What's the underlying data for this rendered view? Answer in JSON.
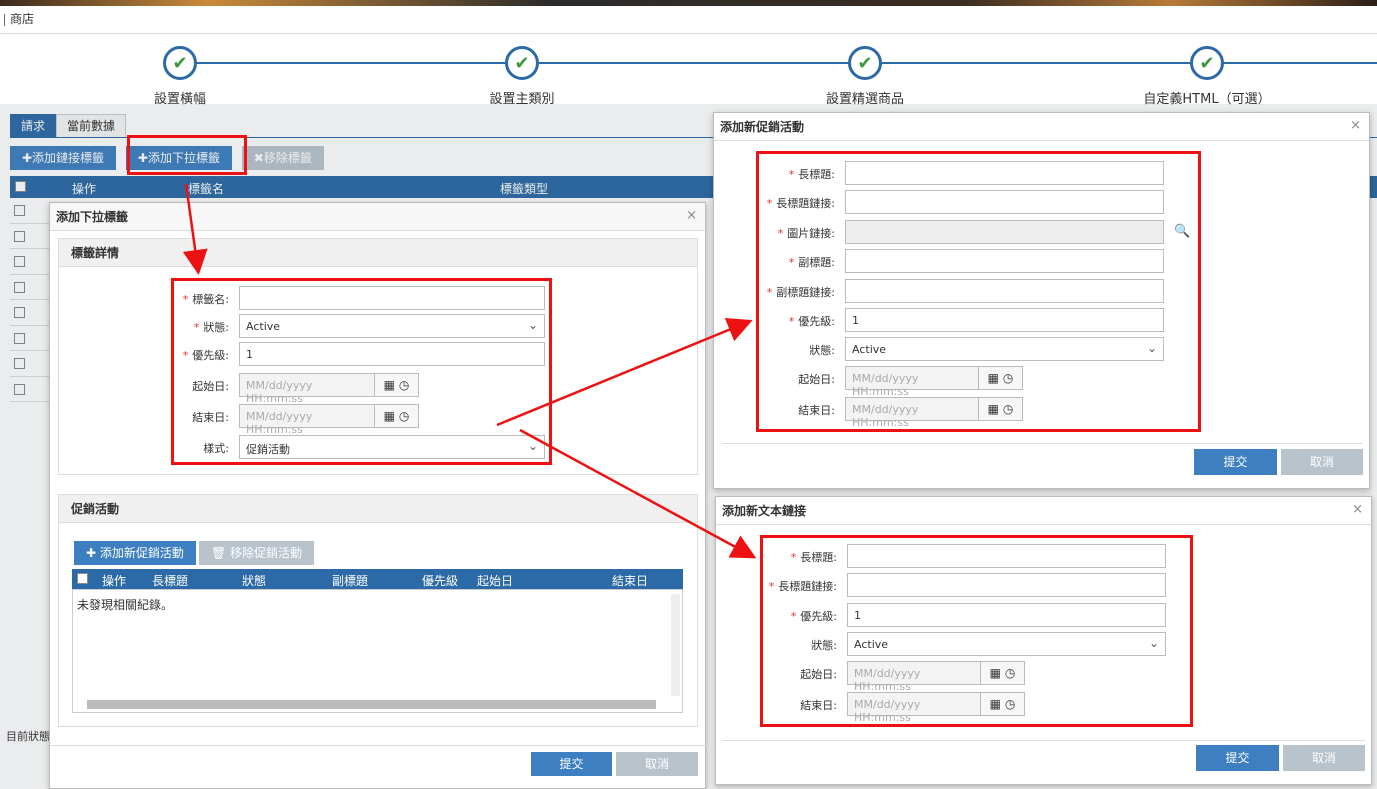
{
  "breadcrumb": "商店",
  "wizard": {
    "steps": [
      {
        "label": "設置橫幅",
        "check": "✔"
      },
      {
        "label": "設置主類別",
        "check": "✔"
      },
      {
        "label": "設置精選商品",
        "check": "✔"
      },
      {
        "label": "自定義HTML（可選）",
        "check": "✔"
      }
    ]
  },
  "bg": {
    "tabs": [
      "請求",
      "當前數據"
    ],
    "toolbar": {
      "add_link": "✚添加鏈接標籤",
      "add_dropdown": "✚添加下拉標籤",
      "remove": "✖移除標籤"
    },
    "grid_headers": [
      "操作",
      "標籤名",
      "標籤類型"
    ],
    "status": "目前狀態"
  },
  "dropdown_modal": {
    "title": "添加下拉標籤",
    "close": "×",
    "details_title": "標籤詳情",
    "labels": {
      "name": "標籤名:",
      "status": "狀態:",
      "priority": "優先級:",
      "start": "起始日:",
      "end": "結束日:",
      "style": "樣式:"
    },
    "required_mark": "*",
    "values": {
      "name": "",
      "status": "Active",
      "priority": "1",
      "style": "促銷活動"
    },
    "date_placeholder": "MM/dd/yyyy HH:mm:ss",
    "promo_title": "促銷活動",
    "promo_add": "✚ 添加新促銷活動",
    "promo_remove": "🗑 移除促銷活動",
    "promo_headers": [
      "操作",
      "長標題",
      "狀態",
      "副標題",
      "優先級",
      "起始日",
      "結束日"
    ],
    "no_records": "未發現相關紀錄。",
    "submit": "提交",
    "cancel": "取消"
  },
  "promo_modal": {
    "title": "添加新促銷活動",
    "close": "×",
    "labels": {
      "long_title": "長標題:",
      "long_title_link": "長標題鏈接:",
      "image_link": "圖片鏈接:",
      "subtitle": "副標題:",
      "subtitle_link": "副標題鏈接:",
      "priority": "優先級:",
      "status": "狀態:",
      "start": "起始日:",
      "end": "結束日:"
    },
    "required_mark": "*",
    "values": {
      "priority": "1",
      "status": "Active"
    },
    "date_placeholder": "MM/dd/yyyy HH:mm:ss",
    "submit": "提交",
    "cancel": "取消"
  },
  "text_link_modal": {
    "title": "添加新文本鏈接",
    "close": "×",
    "labels": {
      "long_title": "長標題:",
      "long_title_link": "長標題鏈接:",
      "priority": "優先級:",
      "status": "狀態:",
      "start": "起始日:",
      "end": "結束日:"
    },
    "required_mark": "*",
    "values": {
      "priority": "1",
      "status": "Active"
    },
    "date_placeholder": "MM/dd/yyyy HH:mm:ss",
    "submit": "提交",
    "cancel": "取消"
  },
  "icons": {
    "calendar": "▦",
    "clock": "◷",
    "chevron": "⌄",
    "search": "🔍"
  },
  "colors": {
    "primary": "#3e7fc1",
    "header": "#2b6aa6",
    "annotation": "#e11111",
    "check": "#3a9a3a"
  }
}
